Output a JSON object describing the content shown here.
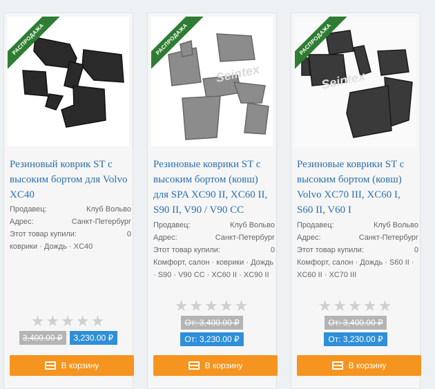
{
  "ribbon_label": "РАСПРОДАЖА",
  "colors": {
    "link": "#2a6fae",
    "ribbon": "#2e7d32",
    "cart": "#f5941e",
    "price_new": "#2f8fd8",
    "price_old": "#b4b4b4"
  },
  "cards": [
    {
      "title": "Резиновый коврик ST с высоким бортом для Volvo XC40",
      "seller_label": "Продавец:",
      "seller": "Клуб Вольво",
      "address_label": "Адрес:",
      "address": "Санкт-Петербург",
      "bought_label": "Этот товар купили:",
      "bought": "0",
      "tags": "коврики · Дождь · XC40",
      "price_old": "3,400.00 ₽",
      "price_new": "3,230.00 ₽",
      "cart_label": "В корзину"
    },
    {
      "title": "Резиновые коврики ST с высоким бортом (ковш) для SPA XC90 II, XC60 II, S90 II, V90 / V90 CC",
      "seller_label": "Продавец:",
      "seller": "Клуб Вольво",
      "address_label": "Адрес:",
      "address": "Санкт-Петербург",
      "bought_label": "Этот товар купили:",
      "bought": "0",
      "tags": "Комфорт, салон · коврики · Дождь · S90 · V90 CC · XC60 II · XC90 II",
      "price_old": "От: 3,400.00 ₽",
      "price_new": "От: 3,230.00 ₽",
      "cart_label": "В корзину"
    },
    {
      "title": "Резиновые коврики ST с высоким бортом (ковш) Volvo XC70 III, XC60 I, S60 II, V60 I",
      "seller_label": "Продавец:",
      "seller": "Клуб Вольво",
      "address_label": "Адрес:",
      "address": "Санкт-Петербург",
      "bought_label": "Этот товар купили:",
      "bought": "0",
      "tags": "Комфорт, салон · Дождь · S60 II · XC60 II · XC70 III",
      "price_old": "От: 3,400.00 ₽",
      "price_new": "От: 3,230.00 ₽",
      "cart_label": "В корзину"
    }
  ]
}
